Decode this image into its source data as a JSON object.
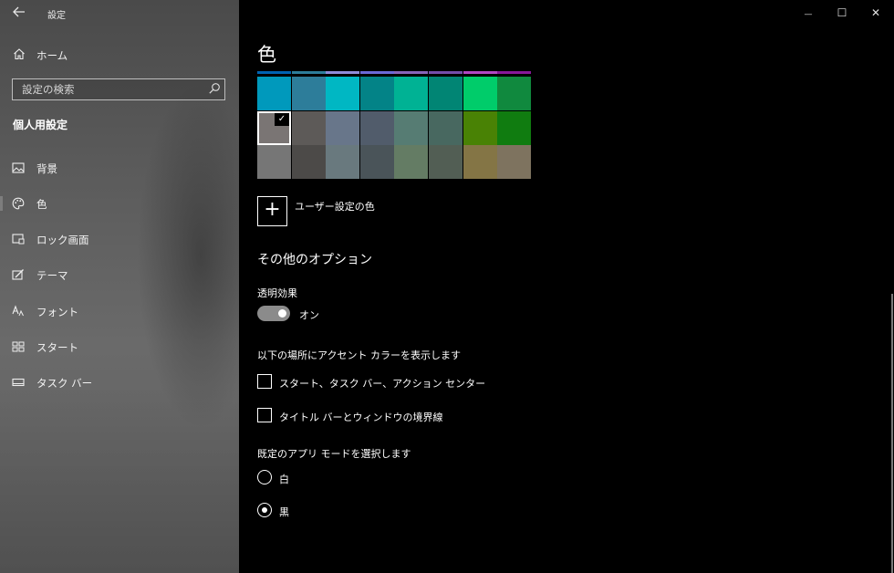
{
  "window": {
    "app_title": "設定",
    "controls": {
      "minimize": "—",
      "maximize": "☐",
      "close": "✕"
    }
  },
  "sidebar": {
    "home_label": "ホーム",
    "search_placeholder": "設定の検索",
    "section_title": "個人用設定",
    "items": [
      {
        "label": "背景",
        "icon": "picture-icon"
      },
      {
        "label": "色",
        "icon": "palette-icon",
        "selected": true
      },
      {
        "label": "ロック画面",
        "icon": "lock-screen-icon"
      },
      {
        "label": "テーマ",
        "icon": "theme-brush-icon"
      },
      {
        "label": "フォント",
        "icon": "font-icon"
      },
      {
        "label": "スタート",
        "icon": "start-grid-icon"
      },
      {
        "label": "タスク バー",
        "icon": "taskbar-icon"
      }
    ]
  },
  "main": {
    "title": "色",
    "swatch_top_colors": [
      "#0063b1",
      "#2d7d9a",
      "#8e8cd8",
      "#6b69d6",
      "#8764b8",
      "#744da9",
      "#b146c2",
      "#881798"
    ],
    "swatches": [
      [
        "#0099bc",
        "#2d7d9a",
        "#00b7c3",
        "#038387",
        "#00b294",
        "#018574",
        "#00cc6a",
        "#10893e"
      ],
      [
        "#7a7574",
        "#5d5a58",
        "#68768a",
        "#515c6b",
        "#567c73",
        "#486860",
        "#498205",
        "#107c10"
      ],
      [
        "#767676",
        "#4c4a48",
        "#69797e",
        "#4a5459",
        "#647c64",
        "#525e54",
        "#847545",
        "#7e735f"
      ]
    ],
    "selected_swatch": {
      "row": 1,
      "col": 0,
      "check": "✓"
    },
    "custom_color_label": "ユーザー設定の色",
    "custom_color_icon": "+",
    "other_options_heading": "その他のオプション",
    "transparency": {
      "label": "透明効果",
      "state": "オン"
    },
    "accent_heading": "以下の場所にアクセント カラーを表示します",
    "accent_checkboxes": [
      {
        "label": "スタート、タスク バー、アクション センター",
        "checked": false
      },
      {
        "label": "タイトル バーとウィンドウの境界線",
        "checked": false
      }
    ],
    "app_mode_heading": "既定のアプリ モードを選択します",
    "app_mode_options": [
      {
        "label": "白",
        "checked": false
      },
      {
        "label": "黒",
        "checked": true
      }
    ]
  }
}
